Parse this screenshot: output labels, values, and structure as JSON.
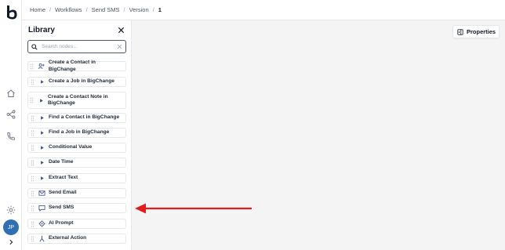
{
  "breadcrumb": {
    "items": [
      "Home",
      "Workflows",
      "Send SMS",
      "Version"
    ],
    "current": "1",
    "separator": "/"
  },
  "sidebar": {
    "logo_icon": "brand-b-logo",
    "icons": [
      "home-icon",
      "workflow-icon",
      "phone-icon",
      "settings-icon"
    ],
    "avatar_initials": "JP",
    "expand_icon": "chevron-right-icon"
  },
  "library": {
    "title": "Library",
    "close_icon": "close-icon",
    "search": {
      "placeholder": "Search nodes...",
      "value": ""
    },
    "nodes": [
      {
        "label": "Create a Contact in BigChange",
        "icon": "person-add-icon"
      },
      {
        "label": "Create a Job in BigChange",
        "icon": "play-icon"
      },
      {
        "label": "Create a Contact Note in BigChange",
        "icon": "play-icon"
      },
      {
        "label": "Find a Contact in BigChange",
        "icon": "play-icon"
      },
      {
        "label": "Find a Job in BigChange",
        "icon": "play-icon"
      },
      {
        "label": "Conditional Value",
        "icon": "play-icon"
      },
      {
        "label": "Date Time",
        "icon": "play-icon"
      },
      {
        "label": "Extract Text",
        "icon": "play-icon"
      },
      {
        "label": "Send Email",
        "icon": "mail-icon"
      },
      {
        "label": "Send SMS",
        "icon": "chat-icon"
      },
      {
        "label": "AI Prompt",
        "icon": "ai-icon"
      },
      {
        "label": "External Action",
        "icon": "fork-icon"
      }
    ]
  },
  "properties_button": {
    "label": "Properties",
    "icon": "panel-icon"
  },
  "colors": {
    "accent": "#e11d1d",
    "avatar": "#2f6fb2",
    "icon_accent": "#3b4a8a"
  }
}
